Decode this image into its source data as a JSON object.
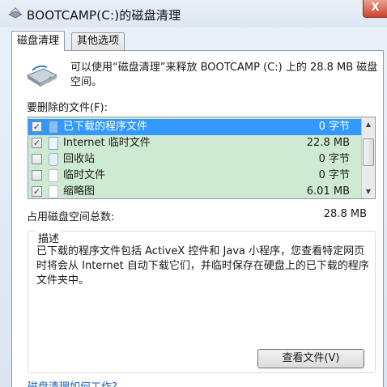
{
  "window": {
    "title": "BOOTCAMP(C:)的磁盘清理",
    "close_label": "X"
  },
  "tabs": [
    {
      "label": "磁盘清理",
      "active": true
    },
    {
      "label": "其他选项",
      "active": false
    }
  ],
  "intro_text": "可以使用“磁盘清理”来释放 BOOTCAMP (C:) 上的 28.8 MB 磁盘空间。",
  "files_label": "要删除的文件(F):",
  "files": [
    {
      "name": "已下载的程序文件",
      "size": "0 字节",
      "checked": true,
      "selected": true,
      "icon": "folder-icon"
    },
    {
      "name": "Internet 临时文件",
      "size": "22.8 MB",
      "checked": true,
      "selected": false,
      "icon": "doc-icon"
    },
    {
      "name": "回收站",
      "size": "0 字节",
      "checked": false,
      "selected": false,
      "icon": "recycle-bin-icon"
    },
    {
      "name": "临时文件",
      "size": "0 字节",
      "checked": false,
      "selected": false,
      "icon": "file-icon"
    },
    {
      "name": "缩略图",
      "size": "6.01 MB",
      "checked": true,
      "selected": false,
      "icon": "file-icon"
    }
  ],
  "total": {
    "label": "占用磁盘空间总数:",
    "value": "28.8 MB"
  },
  "description": {
    "legend": "描述",
    "text": "已下载的程序文件包括 ActiveX 控件和 Java 小程序，您查看特定网页时将会从 Internet 自动下载它们，并临时保存在硬盘上的已下载的程序文件夹中。"
  },
  "view_files_button": "查看文件(V)",
  "help_link": "磁盘清理如何工作?",
  "colors": {
    "selection": "#3399ff",
    "list_background": "#cfead2"
  }
}
